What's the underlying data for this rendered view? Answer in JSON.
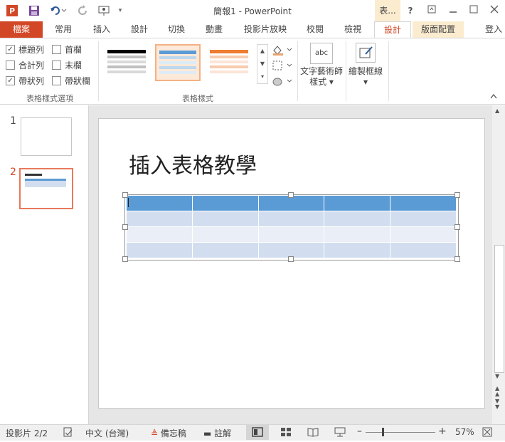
{
  "window": {
    "title": "簡報1 - PowerPoint",
    "context_tab_group": "表...",
    "help": "?",
    "sign_in": "登入"
  },
  "tabs": [
    {
      "label": "檔案"
    },
    {
      "label": "常用"
    },
    {
      "label": "插入"
    },
    {
      "label": "設計"
    },
    {
      "label": "切換"
    },
    {
      "label": "動畫"
    },
    {
      "label": "投影片放映"
    },
    {
      "label": "校閱"
    },
    {
      "label": "檢視"
    },
    {
      "label": "設計"
    },
    {
      "label": "版面配置"
    }
  ],
  "ribbon": {
    "style_options": {
      "label": "表格樣式選項",
      "checkboxes": [
        {
          "label": "標題列",
          "checked": true
        },
        {
          "label": "首欄",
          "checked": false
        },
        {
          "label": "合計列",
          "checked": false
        },
        {
          "label": "末欄",
          "checked": false
        },
        {
          "label": "帶狀列",
          "checked": true
        },
        {
          "label": "帶狀欄",
          "checked": false
        }
      ]
    },
    "table_styles": {
      "label": "表格樣式",
      "styles": [
        {
          "color": "#000000"
        },
        {
          "color": "#5b9bd5"
        },
        {
          "color": "#ed7d31"
        }
      ]
    },
    "wordart": {
      "label1": "文字藝術師",
      "label2": "樣式",
      "icon_text": "abc"
    },
    "draw_borders": {
      "label": "繪製框線"
    }
  },
  "slides": [
    {
      "number": "1"
    },
    {
      "number": "2",
      "selected": true
    }
  ],
  "slide": {
    "title": "插入表格教學"
  },
  "colors": {
    "accent": "#d24726",
    "table_header": "#5b9bd5",
    "table_band1": "#d2deef",
    "table_band2": "#eaeff7"
  },
  "status": {
    "slide_indicator": "投影片 2/2",
    "language": "中文 (台灣)",
    "notes": "備忘稿",
    "comments": "註解",
    "zoom": "57%",
    "zoom_slider_fraction": 0.5
  }
}
